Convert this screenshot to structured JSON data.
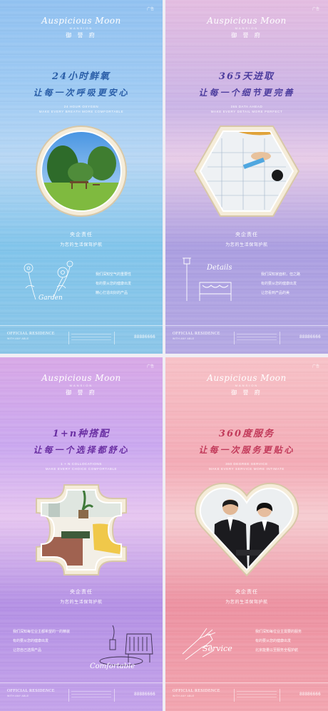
{
  "posters": [
    {
      "tagline": "广告",
      "brand": {
        "logo": "Auspicious Moon",
        "sub": "MANSION",
        "cn": "御 誉 府"
      },
      "headline": {
        "line1": "24小时鲜氧",
        "line2": "让每一次呼吸更安心",
        "color": "#2a5ea8"
      },
      "english": [
        "24 HOUR OXYGEN",
        "MAKE EVERY BREATH MORE COMFORTABLE"
      ],
      "duty": {
        "a": "央企责任",
        "b": "为您的生活保驾护航"
      },
      "lines": [
        "我们深知空气的重要性",
        "有的要从您的健康出发",
        "精心打造出好的产品"
      ],
      "sketch_label": "Garden",
      "footer": {
        "official": "OFFICIAL RESIDENCE",
        "with": "WITH ANY ABLE",
        "phone": "88886666"
      }
    },
    {
      "tagline": "广告",
      "brand": {
        "logo": "Auspicious Moon",
        "sub": "MANSION",
        "cn": "御 誉 府"
      },
      "headline": {
        "line1": "365天进取",
        "line2": "让每一个细节更完善",
        "color": "#4d3d9e"
      },
      "english": [
        "365 DATA AHEAD",
        "MAKE EVERY DETAIL MORE PERFECT"
      ],
      "duty": {
        "a": "央企责任",
        "b": "为您的生活保驾护航"
      },
      "lines": [
        "我们深知家面积，但之路",
        "有的要从您的健康出发",
        "让您看到产品的美"
      ],
      "sketch_label": "Details",
      "footer": {
        "official": "OFFICIAL RESIDENCE",
        "with": "WITH ANY ABLE",
        "phone": "88886666"
      }
    },
    {
      "tagline": "广告",
      "brand": {
        "logo": "Auspicious Moon",
        "sub": "MANSION",
        "cn": "御 誉 府"
      },
      "headline": {
        "line1": "1+n种搭配",
        "line2": "让每一个选择都舒心",
        "color": "#6a2fa3"
      },
      "english": [
        "1 + N COLLOCATIONS",
        "MAKE EVERY CHOICE COMFORTABLE"
      ],
      "duty": {
        "a": "央企责任",
        "b": "为您的生活保驾护航"
      },
      "lines": [
        "我们深知每位业主都希望的一的精装",
        "有的要从您的健康出发",
        "让您自己选择产品"
      ],
      "sketch_label": "Comfortable",
      "footer": {
        "official": "OFFICIAL RESIDENCE",
        "with": "WITH ANY ABLE",
        "phone": "88886666"
      }
    },
    {
      "tagline": "广告",
      "brand": {
        "logo": "Auspicious Moon",
        "sub": "MANSION",
        "cn": "御 誉 府"
      },
      "headline": {
        "line1": "360度服务",
        "line2": "让每一次服务更贴心",
        "color": "#c23a5a"
      },
      "english": [
        "360 DEGREE SERVICE",
        "MAKE EVERY SERVICE MORE INTIMATE"
      ],
      "duty": {
        "a": "央企责任",
        "b": "为您的生活保驾护航"
      },
      "lines": [
        "我们深知每位业主需要的服务",
        "有的要从您的健康出发",
        "北京能量以至服务全程护航"
      ],
      "sketch_label": "Service",
      "footer": {
        "official": "OFFICIAL RESIDENCE",
        "with": "WITH ANY ABLE",
        "phone": "88886666"
      }
    }
  ]
}
